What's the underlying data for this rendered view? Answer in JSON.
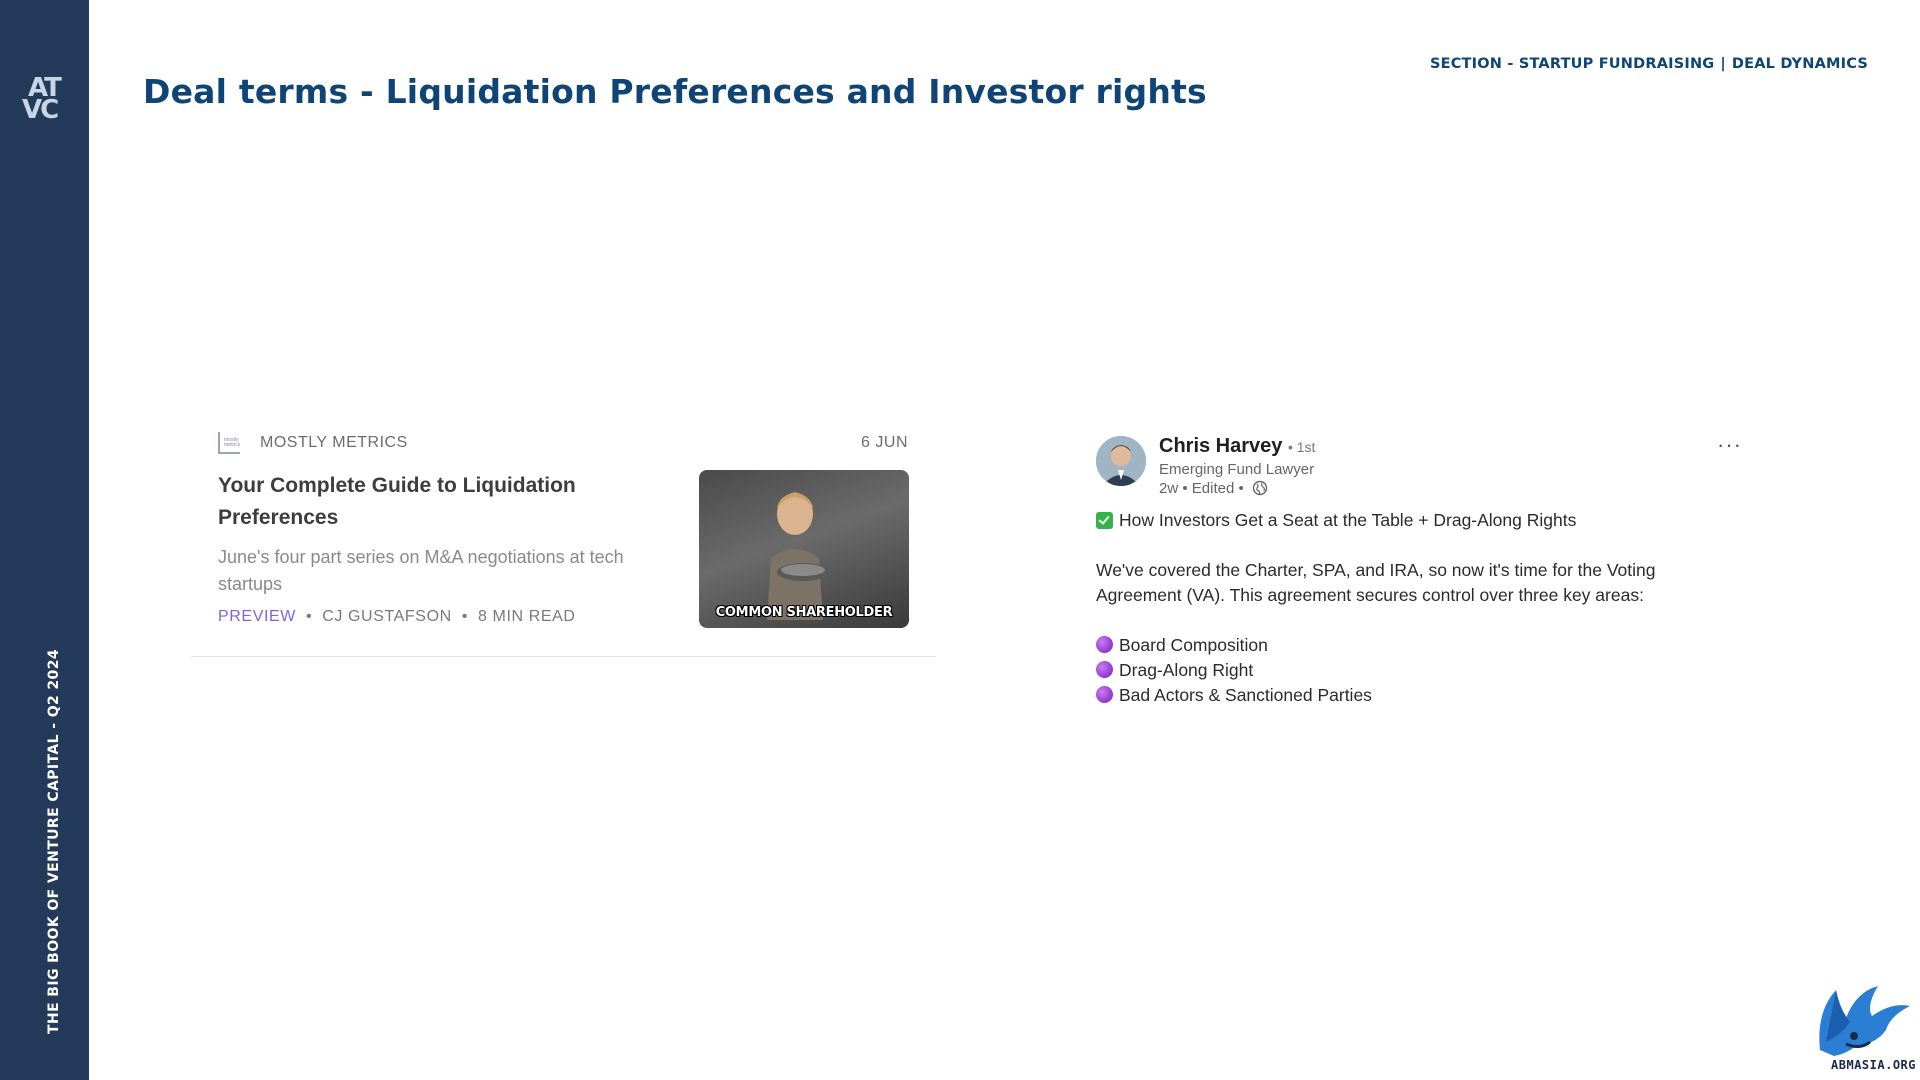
{
  "sidebar": {
    "logo_line1": "AT",
    "logo_line2": "VC",
    "vertical_text": "THE BIG BOOK OF VENTURE CAPITAL - Q2 2024"
  },
  "header": {
    "title": "Deal terms - Liquidation Preferences and Investor rights",
    "section_left": "SECTION - STARTUP FUNDRAISING",
    "section_sep": "|",
    "section_right": "DEAL DYNAMICS"
  },
  "article_card": {
    "publication": "MOSTLY METRICS",
    "date": "6 JUN",
    "title": "Your Complete Guide to Liquidation Preferences",
    "description": "June's four part series on M&A negotiations at tech startups",
    "preview_label": "PREVIEW",
    "author": "CJ GUSTAFSON",
    "read_time": "8 MIN READ",
    "thumbnail_caption": "COMMON SHAREHOLDER"
  },
  "linkedin_post": {
    "author_name": "Chris Harvey",
    "connection_degree": "• 1st",
    "author_role": "Emerging Fund Lawyer",
    "timestamp": "2w • Edited •",
    "headline": "How Investors Get a Seat at the Table + Drag-Along Rights",
    "paragraph_line1": "We've covered the Charter, SPA, and IRA, so now it's time for the Voting",
    "paragraph_line2": "Agreement (VA). This agreement secures control over three key areas:",
    "bullets": [
      "Board Composition",
      "Drag-Along Right",
      "Bad Actors & Sanctioned Parties"
    ],
    "more_label": "···"
  },
  "watermark": {
    "text": "ABMASIA.ORG"
  },
  "colors": {
    "sidebar": "#243a5a",
    "title": "#0f4476",
    "preview": "#7b68d8",
    "check": "#35b34a",
    "bullet": "#9a3fd6"
  }
}
